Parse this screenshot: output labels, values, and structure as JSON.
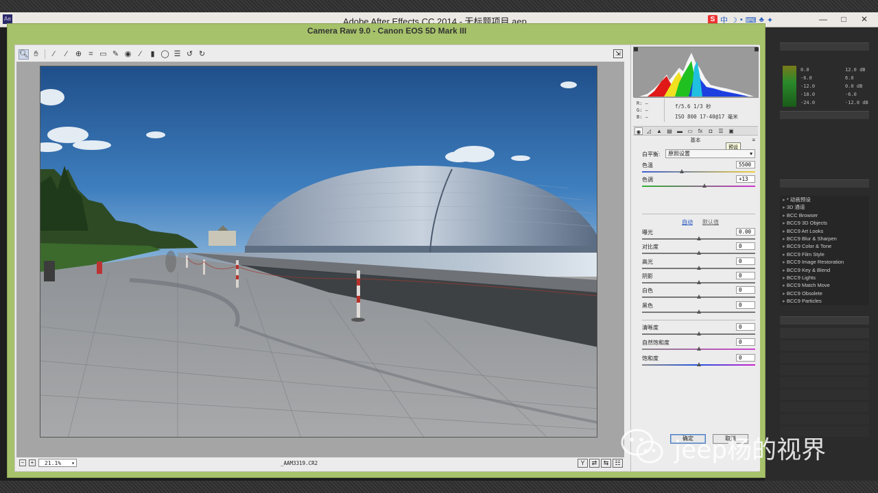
{
  "ae_window": {
    "title": "Adobe After Effects CC 2014 - 无标题项目.aep",
    "logo": "Ae",
    "ime_label": "中",
    "window_buttons": [
      "—",
      "□",
      "✕"
    ]
  },
  "ae_background": {
    "meter_labels_left": [
      "0.0",
      "-6.0",
      "-12.0",
      "-18.0",
      "-24.0"
    ],
    "meter_labels_right": [
      "12.0 dB",
      "6.0",
      "0.0 dB",
      "-6.0",
      "-12.0 dB"
    ],
    "effects_list": [
      "* 动画预设",
      "3D 通道",
      "BCC Browser",
      "BCC9 3D Objects",
      "BCC9 Art Looks",
      "BCC9 Blur & Sharpen",
      "BCC9 Color & Tone",
      "BCC9 Film Style",
      "BCC9 Image Restoration",
      "BCC9 Key & Blend",
      "BCC9 Lights",
      "BCC9 Match Move",
      "BCC9 Obsolete",
      "BCC9 Particles"
    ]
  },
  "camera_raw": {
    "title": "Camera Raw 9.0 -  Canon EOS 5D Mark III",
    "toolbar_icons": [
      "zoom-icon",
      "hand-icon",
      "white-balance-icon",
      "color-sampler-icon",
      "target-adjust-icon",
      "crop-icon",
      "straighten-icon",
      "spot-removal-icon",
      "red-eye-icon",
      "adjustment-brush-icon",
      "graduated-filter-icon",
      "radial-filter-icon",
      "presets-list-icon",
      "rotate-ccw-icon",
      "rotate-cw-icon"
    ],
    "zoom_value": "21.1%",
    "filename": "_AAM3319.CR2",
    "rgb_labels": [
      "R:",
      "G:",
      "B:"
    ],
    "rgb_values": [
      "—",
      "—",
      "—"
    ],
    "exif_line1": "f/5.6  1/3 秒",
    "exif_line2": "ISO 800  17-40@17 毫米",
    "panel_title": "基本",
    "tooltip": "预设",
    "wb_label": "白平衡:",
    "wb_value": "原照设置",
    "auto": "自动",
    "default": "默认值",
    "sliders": [
      {
        "label": "色温",
        "value": "5500",
        "pos": 0.35
      },
      {
        "label": "色调",
        "value": "+13",
        "pos": 0.55
      },
      {
        "label": "曝光",
        "value": "0.00",
        "pos": 0.5
      },
      {
        "label": "对比度",
        "value": "0",
        "pos": 0.5
      },
      {
        "label": "高光",
        "value": "0",
        "pos": 0.5
      },
      {
        "label": "阴影",
        "value": "0",
        "pos": 0.5
      },
      {
        "label": "白色",
        "value": "0",
        "pos": 0.5
      },
      {
        "label": "黑色",
        "value": "0",
        "pos": 0.5
      },
      {
        "label": "清晰度",
        "value": "0",
        "pos": 0.5
      },
      {
        "label": "自然饱和度",
        "value": "0",
        "pos": 0.5
      },
      {
        "label": "饱和度",
        "value": "0",
        "pos": 0.5
      }
    ],
    "ok_button": "确定",
    "cancel_button": "取消"
  },
  "watermark": "jeep杨的视界",
  "colors": {
    "dialog_frame": "#a6c26a",
    "sky_top": "#1f4f8a",
    "sky_bottom": "#6aa0d0"
  }
}
